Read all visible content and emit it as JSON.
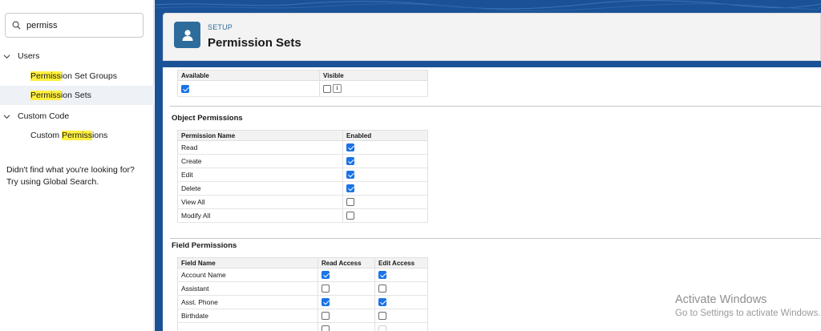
{
  "sidebar": {
    "search_value": "permiss",
    "tree": {
      "users_label": "Users",
      "users_children": [
        {
          "pre": "",
          "hl": "Permiss",
          "post": "ion Set Groups"
        },
        {
          "pre": "",
          "hl": "Permiss",
          "post": "ion Sets"
        }
      ],
      "custom_code_label": "Custom Code",
      "custom_code_children": [
        {
          "pre": "Custom ",
          "hl": "Permiss",
          "post": "ions"
        }
      ]
    },
    "help_line1": "Didn't find what you're looking for?",
    "help_line2": "Try using Global Search."
  },
  "header": {
    "eyebrow": "SETUP",
    "title": "Permission Sets",
    "icon": "user-icon"
  },
  "availability_table": {
    "headers": [
      "Available",
      "Visible"
    ],
    "available": true,
    "visible": false
  },
  "object_permissions": {
    "title": "Object Permissions",
    "headers": [
      "Permission Name",
      "Enabled"
    ],
    "rows": [
      {
        "name": "Read",
        "enabled": true
      },
      {
        "name": "Create",
        "enabled": true
      },
      {
        "name": "Edit",
        "enabled": true
      },
      {
        "name": "Delete",
        "enabled": true
      },
      {
        "name": "View All",
        "enabled": false
      },
      {
        "name": "Modify All",
        "enabled": false
      }
    ]
  },
  "field_permissions": {
    "title": "Field Permissions",
    "headers": [
      "Field Name",
      "Read Access",
      "Edit Access"
    ],
    "rows": [
      {
        "name": "Account Name",
        "read": true,
        "edit": true
      },
      {
        "name": "Assistant",
        "read": false,
        "edit": false
      },
      {
        "name": "Asst. Phone",
        "read": true,
        "edit": true
      },
      {
        "name": "Birthdate",
        "read": false,
        "edit": false
      }
    ]
  },
  "watermark": {
    "line1": "Activate Windows",
    "line2": "Go to Settings to activate Windows."
  },
  "colors": {
    "brand_blue": "#1b5297",
    "checkbox_blue": "#1a73e8",
    "highlight": "#fff03f"
  }
}
